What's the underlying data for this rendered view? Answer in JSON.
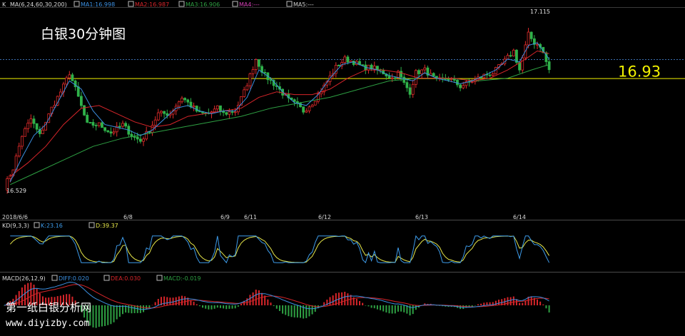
{
  "chart_data": [
    {
      "type": "candlestick",
      "watermark_title": "白银30分钟图",
      "indicator_header": "MA(6,24,60,30,200)",
      "panel_label": "K",
      "ma_legend": [
        {
          "label": "MA1:16.998",
          "color": "#3b8fe0"
        },
        {
          "label": "MA2:16.987",
          "color": "#d7252a"
        },
        {
          "label": "MA3:16.906",
          "color": "#2ea043"
        },
        {
          "label": "MA4:---",
          "color": "#d43fb5"
        },
        {
          "label": "MA5:---",
          "color": "#cfcfcf"
        }
      ],
      "high_label": "17.115",
      "low_label": "16.529",
      "current_price": "16.93",
      "current_price_color": "#f2f200",
      "ylim": [
        16.44,
        17.18
      ],
      "x_ticks": [
        "2018/6/6",
        "6/8",
        "6/9",
        "6/11",
        "6/12",
        "6/13",
        "6/14"
      ],
      "close_path": [
        [
          0,
          16.53
        ],
        [
          3,
          16.6
        ],
        [
          6,
          16.72
        ],
        [
          9,
          16.78
        ],
        [
          12,
          16.72
        ],
        [
          16,
          16.82
        ],
        [
          20,
          16.9
        ],
        [
          22,
          16.95
        ],
        [
          25,
          16.86
        ],
        [
          28,
          16.76
        ],
        [
          32,
          16.76
        ],
        [
          36,
          16.73
        ],
        [
          40,
          16.76
        ],
        [
          43,
          16.72
        ],
        [
          46,
          16.7
        ],
        [
          49,
          16.74
        ],
        [
          52,
          16.8
        ],
        [
          56,
          16.8
        ],
        [
          60,
          16.86
        ],
        [
          64,
          16.82
        ],
        [
          66,
          16.8
        ],
        [
          69,
          16.8
        ],
        [
          72,
          16.82
        ],
        [
          74,
          16.8
        ],
        [
          78,
          16.81
        ],
        [
          81,
          16.88
        ],
        [
          85,
          17.0
        ],
        [
          88,
          16.94
        ],
        [
          92,
          16.9
        ],
        [
          96,
          16.85
        ],
        [
          99,
          16.83
        ],
        [
          101,
          16.81
        ],
        [
          104,
          16.84
        ],
        [
          108,
          16.9
        ],
        [
          112,
          16.97
        ],
        [
          115,
          17.0
        ],
        [
          118,
          16.99
        ],
        [
          121,
          16.97
        ],
        [
          124,
          16.97
        ],
        [
          128,
          16.95
        ],
        [
          131,
          16.93
        ],
        [
          133,
          16.95
        ],
        [
          135,
          16.91
        ],
        [
          137,
          16.88
        ],
        [
          139,
          16.95
        ],
        [
          142,
          16.96
        ],
        [
          146,
          16.92
        ],
        [
          150,
          16.93
        ],
        [
          154,
          16.9
        ],
        [
          158,
          16.92
        ],
        [
          162,
          16.94
        ],
        [
          165,
          16.95
        ],
        [
          168,
          16.98
        ],
        [
          172,
          17.03
        ],
        [
          174,
          16.96
        ],
        [
          177,
          17.09
        ],
        [
          179,
          17.06
        ],
        [
          181,
          17.05
        ],
        [
          184,
          16.96
        ]
      ],
      "ma1_path": [
        [
          2,
          16.55
        ],
        [
          6,
          16.64
        ],
        [
          10,
          16.72
        ],
        [
          14,
          16.76
        ],
        [
          18,
          16.84
        ],
        [
          22,
          16.92
        ],
        [
          26,
          16.89
        ],
        [
          30,
          16.81
        ],
        [
          34,
          16.76
        ],
        [
          38,
          16.75
        ],
        [
          42,
          16.74
        ],
        [
          46,
          16.72
        ],
        [
          50,
          16.74
        ],
        [
          54,
          16.78
        ],
        [
          58,
          16.82
        ],
        [
          62,
          16.83
        ],
        [
          66,
          16.81
        ],
        [
          70,
          16.8
        ],
        [
          74,
          16.81
        ],
        [
          78,
          16.81
        ],
        [
          82,
          16.86
        ],
        [
          86,
          16.96
        ],
        [
          90,
          16.93
        ],
        [
          94,
          16.88
        ],
        [
          98,
          16.84
        ],
        [
          102,
          16.83
        ],
        [
          106,
          16.87
        ],
        [
          110,
          16.93
        ],
        [
          114,
          16.98
        ],
        [
          118,
          16.99
        ],
        [
          122,
          16.97
        ],
        [
          126,
          16.96
        ],
        [
          130,
          16.94
        ],
        [
          134,
          16.93
        ],
        [
          138,
          16.92
        ],
        [
          142,
          16.95
        ],
        [
          146,
          16.93
        ],
        [
          150,
          16.92
        ],
        [
          154,
          16.91
        ],
        [
          158,
          16.92
        ],
        [
          162,
          16.94
        ],
        [
          166,
          16.96
        ],
        [
          170,
          17.0
        ],
        [
          174,
          16.99
        ],
        [
          177,
          17.05
        ],
        [
          180,
          17.06
        ],
        [
          184,
          17.0
        ]
      ],
      "ma2_path": [
        [
          2,
          16.57
        ],
        [
          8,
          16.62
        ],
        [
          14,
          16.68
        ],
        [
          20,
          16.76
        ],
        [
          26,
          16.82
        ],
        [
          32,
          16.83
        ],
        [
          38,
          16.8
        ],
        [
          44,
          16.77
        ],
        [
          50,
          16.75
        ],
        [
          56,
          16.76
        ],
        [
          62,
          16.79
        ],
        [
          68,
          16.8
        ],
        [
          74,
          16.81
        ],
        [
          80,
          16.82
        ],
        [
          86,
          16.86
        ],
        [
          92,
          16.88
        ],
        [
          98,
          16.87
        ],
        [
          104,
          16.87
        ],
        [
          110,
          16.89
        ],
        [
          116,
          16.93
        ],
        [
          122,
          16.96
        ],
        [
          128,
          16.96
        ],
        [
          134,
          16.95
        ],
        [
          140,
          16.93
        ],
        [
          146,
          16.93
        ],
        [
          152,
          16.93
        ],
        [
          158,
          16.92
        ],
        [
          164,
          16.93
        ],
        [
          170,
          16.96
        ],
        [
          176,
          17.0
        ],
        [
          180,
          17.03
        ],
        [
          184,
          17.02
        ]
      ],
      "ma3_path": [
        [
          2,
          16.54
        ],
        [
          10,
          16.58
        ],
        [
          20,
          16.63
        ],
        [
          30,
          16.68
        ],
        [
          40,
          16.71
        ],
        [
          50,
          16.73
        ],
        [
          60,
          16.75
        ],
        [
          70,
          16.77
        ],
        [
          80,
          16.79
        ],
        [
          90,
          16.82
        ],
        [
          100,
          16.84
        ],
        [
          110,
          16.86
        ],
        [
          120,
          16.89
        ],
        [
          130,
          16.92
        ],
        [
          140,
          16.93
        ],
        [
          150,
          16.93
        ],
        [
          160,
          16.92
        ],
        [
          170,
          16.93
        ],
        [
          178,
          16.96
        ],
        [
          184,
          16.98
        ]
      ]
    },
    {
      "type": "line",
      "indicator_header": "KD(9,3,3)",
      "series": [
        {
          "name": "K:23.16",
          "color": "#3d9be9"
        },
        {
          "name": "D:39.37",
          "color": "#e8e84a"
        }
      ],
      "ylim": [
        0,
        100
      ]
    },
    {
      "type": "bar",
      "indicator_header": "MACD(26,12,9)",
      "series": [
        {
          "name": "DIFF:0.020",
          "color": "#3b8fe0"
        },
        {
          "name": "DEA:0.030",
          "color": "#d7252a"
        },
        {
          "name": "MACD:-0.019",
          "color": "#2ea043"
        }
      ],
      "up_color": "#d7252a",
      "down_color": "#2ea043"
    }
  ],
  "footer": {
    "site_name": "第一纸白银分析网",
    "site_url": "www.diyizby.com"
  }
}
